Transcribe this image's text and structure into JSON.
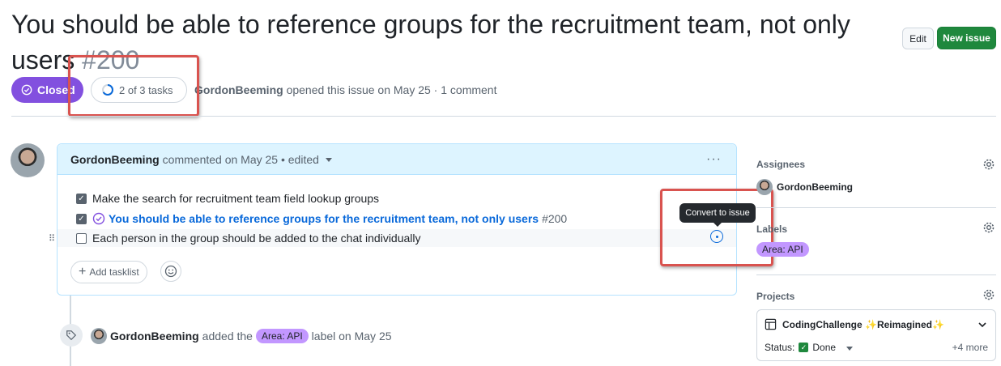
{
  "header": {
    "title": "You should be able to reference groups for the recruitment team, not only users",
    "number": "#200",
    "edit_label": "Edit",
    "new_issue_label": "New issue"
  },
  "status": {
    "state": "Closed",
    "tasks_label": "2 of 3 tasks",
    "tasks_progress": 0.67,
    "author": "GordonBeeming",
    "opened_text": "opened this issue on May 25 · 1 comment"
  },
  "comment": {
    "author": "GordonBeeming",
    "meta": "commented on May 25 • edited",
    "more": "···",
    "tasks": [
      {
        "text": "Make the search for recruitment team field lookup groups",
        "checked": true
      },
      {
        "text": "You should be able to reference groups for the recruitment team, not only users",
        "number": "#200",
        "checked": true,
        "linked": true
      },
      {
        "text": "Each person in the group should be added to the chat individually",
        "checked": false
      }
    ],
    "add_tasklist_label": "Add tasklist",
    "tooltip": "Convert to issue"
  },
  "timeline": {
    "event_author": "GordonBeeming",
    "event_action": "added the",
    "event_label": "Area: API",
    "event_suffix": "label on May 25"
  },
  "sidebar": {
    "assignees_heading": "Assignees",
    "assignee": "GordonBeeming",
    "labels_heading": "Labels",
    "label": "Area: API",
    "projects_heading": "Projects",
    "project_name": "CodingChallenge ✨Reimagined✨",
    "status_prefix": "Status:",
    "status_value": "Done",
    "more": "+4 more"
  },
  "colors": {
    "closed": "#8250df",
    "new_issue": "#1f883d",
    "link": "#0969da",
    "label": "#c297ff",
    "annotation": "#d9534f"
  }
}
